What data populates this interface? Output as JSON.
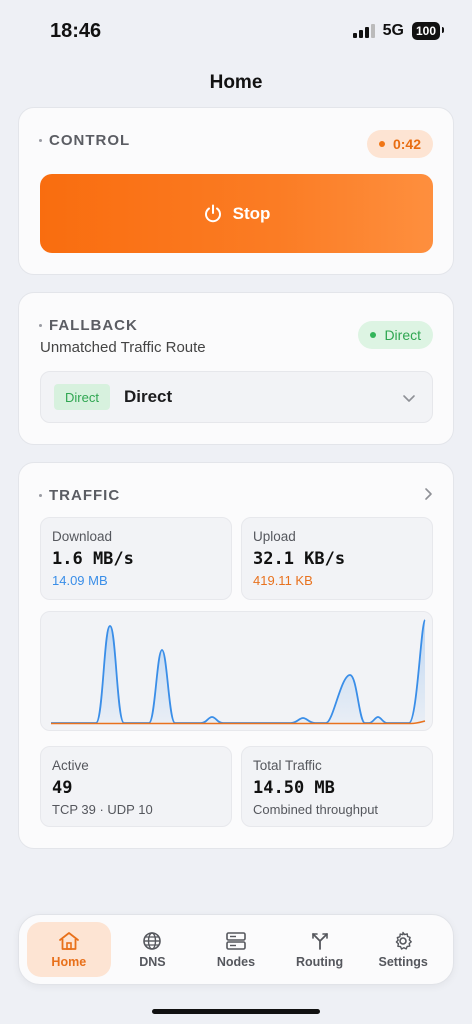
{
  "status_bar": {
    "time": "18:46",
    "network": "5G",
    "battery": "100"
  },
  "page": {
    "title": "Home"
  },
  "control": {
    "section_label": "CONTROL",
    "timer": "0:42",
    "stop_label": "Stop"
  },
  "fallback": {
    "section_label": "FALLBACK",
    "subtitle": "Unmatched Traffic Route",
    "status": "Direct",
    "route_tag": "Direct",
    "route_value": "Direct"
  },
  "traffic": {
    "section_label": "TRAFFIC",
    "download": {
      "label": "Download",
      "rate": "1.6 MB/s",
      "total": "14.09 MB"
    },
    "upload": {
      "label": "Upload",
      "rate": "32.1 KB/s",
      "total": "419.11 KB"
    },
    "active": {
      "label": "Active",
      "value": "49",
      "detail": "TCP 39 · UDP 10"
    },
    "total": {
      "label": "Total Traffic",
      "value": "14.50 MB",
      "detail": "Combined throughput"
    },
    "colors": {
      "download": "#3a8ee8",
      "upload": "#e8721e"
    }
  },
  "tabs": [
    {
      "label": "Home",
      "icon": "home-icon"
    },
    {
      "label": "DNS",
      "icon": "globe-icon"
    },
    {
      "label": "Nodes",
      "icon": "server-icon"
    },
    {
      "label": "Routing",
      "icon": "routing-icon"
    },
    {
      "label": "Settings",
      "icon": "gear-icon"
    }
  ],
  "colors": {
    "accent": "#f96d0f",
    "success": "#33b55a"
  }
}
